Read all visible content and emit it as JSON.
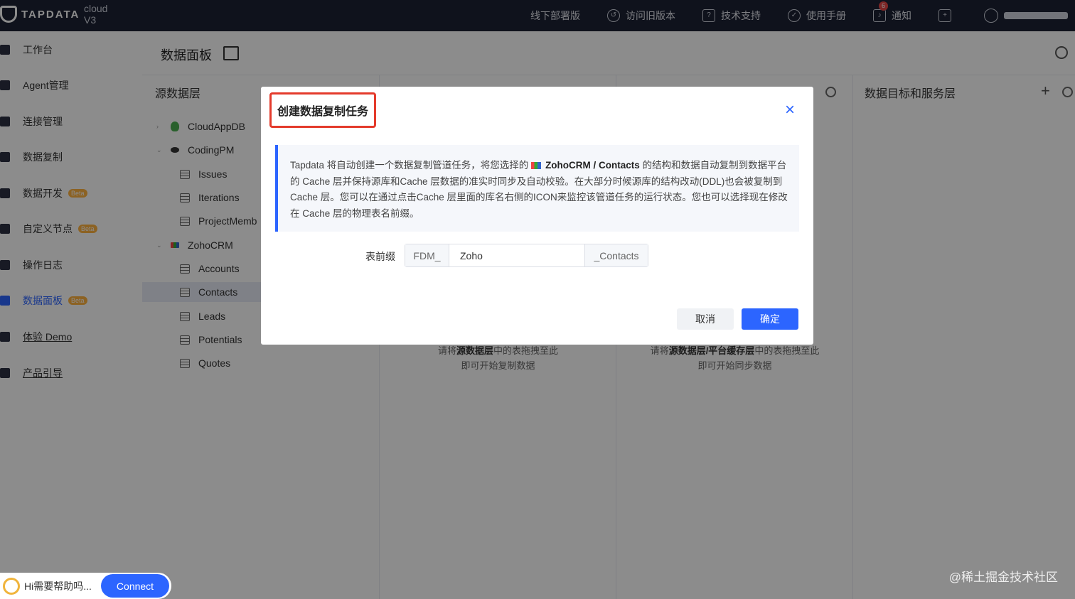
{
  "topbar": {
    "brand": "TAPDATA",
    "version": "cloud V3",
    "nav": [
      {
        "label": "线下部署版",
        "icon": ""
      },
      {
        "label": "访问旧版本",
        "icon": "history-icon"
      },
      {
        "label": "技术支持",
        "icon": "help-icon"
      },
      {
        "label": "使用手册",
        "icon": "manual-icon"
      },
      {
        "label": "通知",
        "icon": "bell-icon",
        "badge": "6"
      }
    ]
  },
  "sidebar": {
    "items": [
      {
        "label": "工作台",
        "beta": ""
      },
      {
        "label": "Agent管理",
        "beta": ""
      },
      {
        "label": "连接管理",
        "beta": ""
      },
      {
        "label": "数据复制",
        "beta": ""
      },
      {
        "label": "数据开发",
        "beta": "Beta"
      },
      {
        "label": "自定义节点",
        "beta": "Beta"
      },
      {
        "label": "操作日志",
        "beta": ""
      },
      {
        "label": "数据面板",
        "beta": "Beta",
        "active": true
      },
      {
        "label": "体验 Demo",
        "beta": ""
      },
      {
        "label": "产品引导",
        "beta": ""
      }
    ]
  },
  "main": {
    "title": "数据面板",
    "source_title": "源数据层",
    "target_title": "数据目标和服务层",
    "tree": [
      {
        "label": "CloudAppDB",
        "type": "db",
        "color": "#4caf50"
      },
      {
        "label": "CodingPM",
        "type": "db",
        "color": "#333333"
      },
      {
        "label": "Issues",
        "type": "table"
      },
      {
        "label": "Iterations",
        "type": "table"
      },
      {
        "label": "ProjectMemb",
        "type": "table"
      },
      {
        "label": "ZohoCRM",
        "type": "db",
        "color": "#e64545"
      },
      {
        "label": "Accounts",
        "type": "table"
      },
      {
        "label": "Contacts",
        "type": "table",
        "selected": true
      },
      {
        "label": "Leads",
        "type": "table"
      },
      {
        "label": "Potentials",
        "type": "table"
      },
      {
        "label": "Quotes",
        "type": "table"
      }
    ],
    "hint_a_line1_pre": "请将",
    "hint_a_line1_bold": "源数据层",
    "hint_a_line1_post": "中的表拖拽至此",
    "hint_a_line2": "即可开始复制数据",
    "hint_b_line1_pre": "请将",
    "hint_b_line1_bold": "源数据层/平台缓存层",
    "hint_b_line1_post": "中的表拖拽至此",
    "hint_b_line2": "即可开始同步数据"
  },
  "modal": {
    "title": "创建数据复制任务",
    "info_pre": "Tapdata 将自动创建一个数据复制管道任务，将您选择的",
    "info_source": "ZohoCRM / Contacts",
    "info_post": "的结构和数据自动复制到数据平台的 Cache 层并保持源库和Cache 层数据的准实时同步及自动校验。在大部分时候源库的结构改动(DDL)也会被复制到Cache 层。您可以在通过点击Cache 层里面的库名右侧的ICON来监控该管道任务的运行状态。您也可以选择现在修改在 Cache 层的物理表名前缀。",
    "prefix_label": "表前缀",
    "prefix_pre": "FDM_",
    "prefix_value": "Zoho",
    "prefix_suf": "_Contacts",
    "cancel": "取消",
    "ok": "确定"
  },
  "help": {
    "text": "Hi需要帮助吗...",
    "connect": "Connect"
  },
  "watermark": "@稀土掘金技术社区",
  "colors": {
    "accent": "#2c65ff",
    "highlight": "#e43b2c",
    "topbar": "#1d2234"
  }
}
